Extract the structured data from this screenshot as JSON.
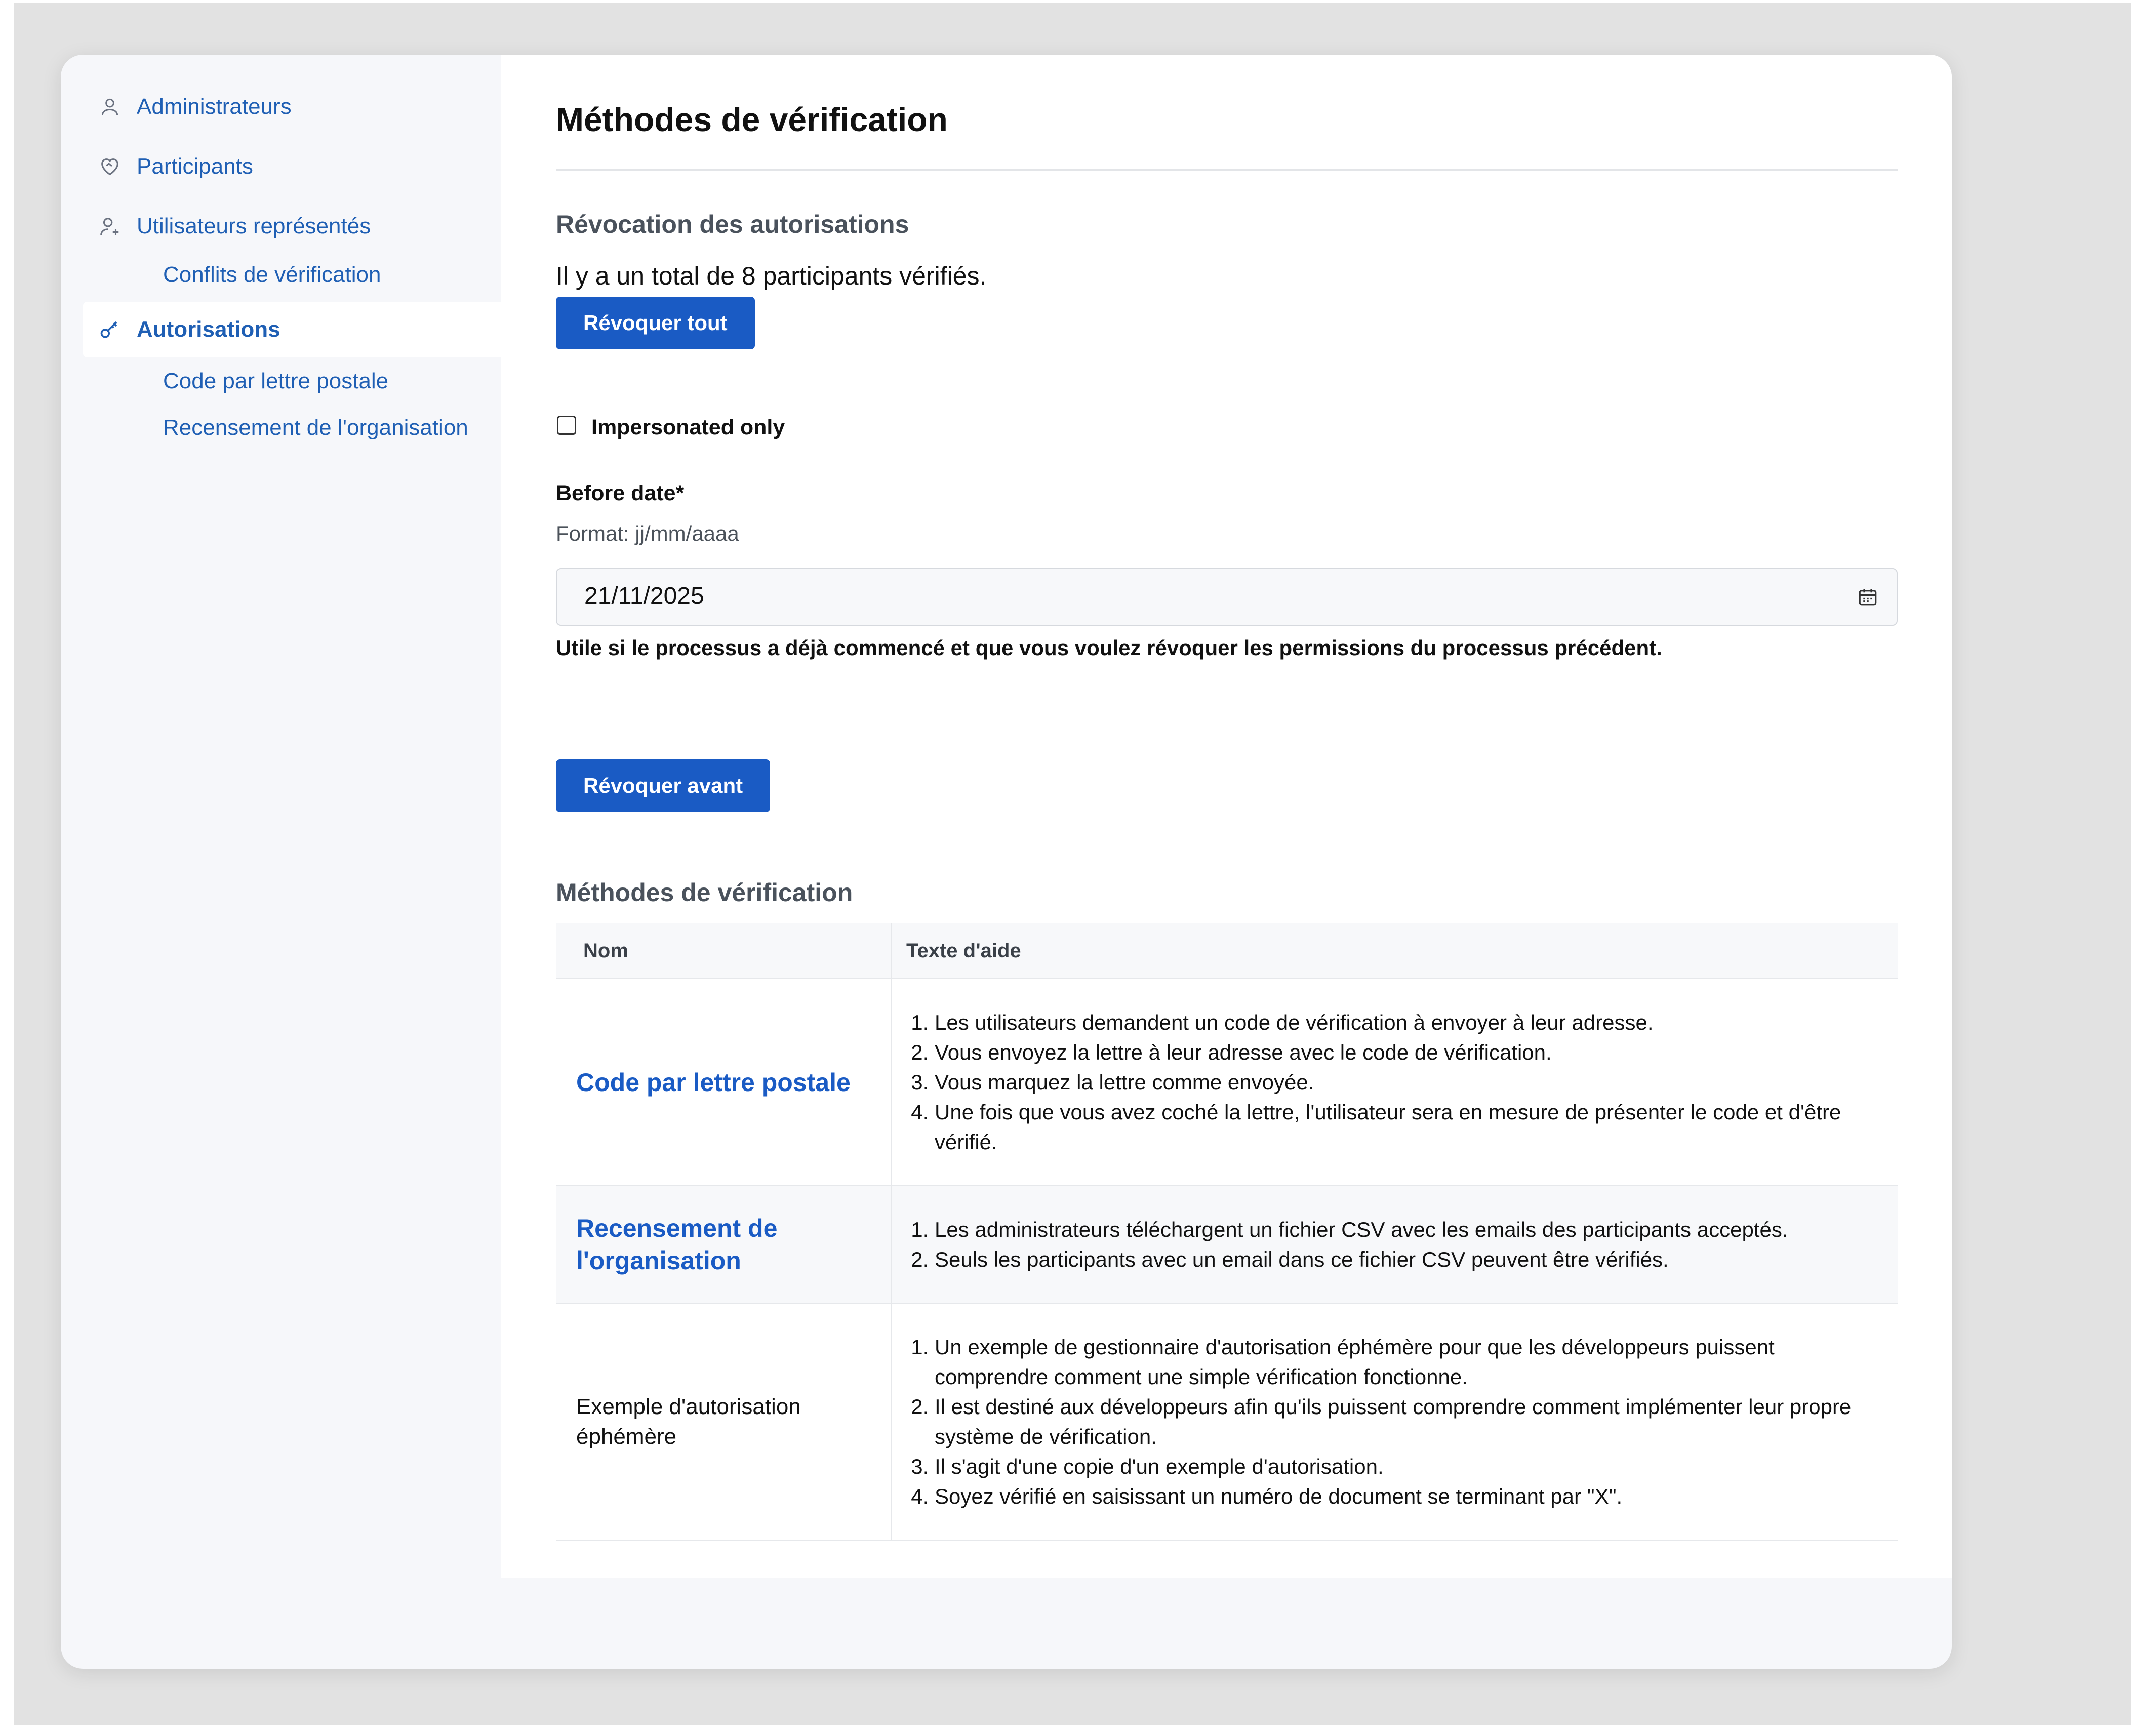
{
  "sidebar": {
    "items": [
      {
        "label": "Administrateurs",
        "icon": "user-icon"
      },
      {
        "label": "Participants",
        "icon": "heart-handshake-icon"
      },
      {
        "label": "Utilisateurs représentés",
        "icon": "user-plus-icon"
      },
      {
        "label": "Conflits de vérification"
      },
      {
        "label": "Autorisations",
        "icon": "key-icon",
        "active": true
      },
      {
        "label": "Code par lettre postale"
      },
      {
        "label": "Recensement de l'organisation"
      }
    ]
  },
  "main": {
    "title": "Méthodes de vérification",
    "revocation": {
      "heading": "Révocation des autorisations",
      "summary": "Il y a un total de 8 participants vérifiés.",
      "revoke_all_label": "Révoquer tout",
      "impersonated_label": "Impersonated only",
      "impersonated_checked": false,
      "date_label": "Before date*",
      "date_format": "Format: jj/mm/aaaa",
      "date_value": "21/11/2025",
      "date_help": "Utile si le processus a déjà commencé et que vous voulez révoquer les permissions du processus précédent.",
      "revoke_before_label": "Révoquer avant"
    },
    "methods": {
      "heading": "Méthodes de vérification",
      "columns": [
        "Nom",
        "Texte d'aide"
      ],
      "rows": [
        {
          "name": "Code par lettre postale",
          "link": true,
          "help": [
            "Les utilisateurs demandent un code de vérification à envoyer à leur adresse.",
            "Vous envoyez la lettre à leur adresse avec le code de vérification.",
            "Vous marquez la lettre comme envoyée.",
            "Une fois que vous avez coché la lettre, l'utilisateur sera en mesure de présenter le code et d'être vérifié."
          ]
        },
        {
          "name": "Recensement de l'organisation",
          "link": true,
          "help": [
            "Les administrateurs téléchargent un fichier CSV avec les emails des participants acceptés.",
            "Seuls les participants avec un email dans ce fichier CSV peuvent être vérifiés."
          ]
        },
        {
          "name": "Exemple d'autorisation éphémère",
          "link": false,
          "help": [
            "Un exemple de gestionnaire d'autorisation éphémère pour que les développeurs puissent comprendre comment une simple vérification fonctionne.",
            "Il est destiné aux développeurs afin qu'ils puissent comprendre comment implémenter leur propre système de vérification.",
            "Il s'agit d'une copie d'un exemple d'autorisation.",
            "Soyez vérifié en saisissant un numéro de document se terminant par \"X\"."
          ]
        }
      ]
    }
  },
  "colors": {
    "accent": "#1a5bc4",
    "link": "#1f5fb4",
    "sidebar_bg": "#f6f7fa"
  }
}
